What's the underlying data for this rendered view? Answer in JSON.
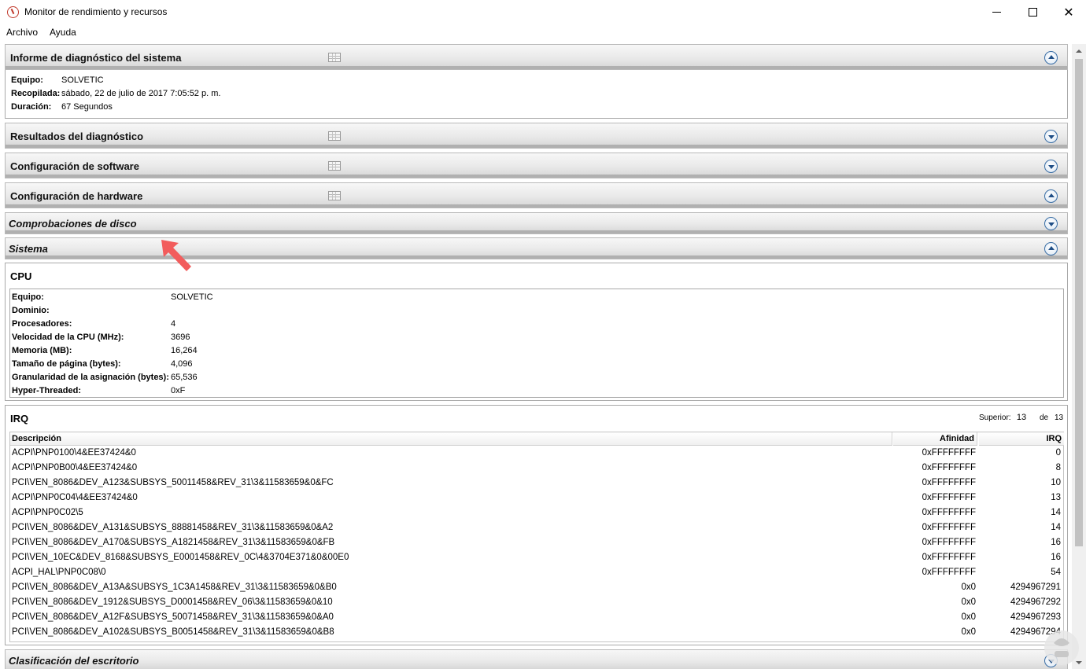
{
  "window": {
    "title": "Monitor de rendimiento y recursos",
    "minimize_icon": "minimize-icon",
    "maximize_icon": "maximize-icon",
    "close_glyph": "✕"
  },
  "menu": {
    "items": [
      "Archivo",
      "Ayuda"
    ]
  },
  "sections": {
    "informe": {
      "title": "Informe de diagnóstico del sistema",
      "expanded": true,
      "fields": [
        {
          "label": "Equipo:",
          "value": "SOLVETIC"
        },
        {
          "label": "Recopilada:",
          "value": "sábado, 22 de julio de 2017 7:05:52 p. m."
        },
        {
          "label": "Duración:",
          "value": "67 Segundos"
        }
      ]
    },
    "resultados": {
      "title": "Resultados del diagnóstico",
      "expanded": false
    },
    "software": {
      "title": "Configuración de software",
      "expanded": false
    },
    "hardware": {
      "title": "Configuración de hardware",
      "expanded": true
    },
    "disco": {
      "title": "Comprobaciones de disco",
      "expanded": false
    },
    "sistema": {
      "title": "Sistema",
      "expanded": true
    },
    "escritorio": {
      "title": "Clasificación del escritorio",
      "expanded": false
    }
  },
  "cpu": {
    "title": "CPU",
    "fields": [
      {
        "label": "Equipo:",
        "value": "SOLVETIC"
      },
      {
        "label": "Dominio:",
        "value": ""
      },
      {
        "label": "Procesadores:",
        "value": "4"
      },
      {
        "label": "Velocidad de la CPU (MHz):",
        "value": "3696"
      },
      {
        "label": "Memoria (MB):",
        "value": "16,264"
      },
      {
        "label": "Tamaño de página (bytes):",
        "value": "4,096"
      },
      {
        "label": "Granularidad de la asignación (bytes):",
        "value": "65,536"
      },
      {
        "label": "Hyper-Threaded:",
        "value": "0xF"
      }
    ]
  },
  "irq": {
    "title": "IRQ",
    "superior_label": "Superior:",
    "superior_value": "13",
    "de_label": "de",
    "de_value": "13",
    "columns": [
      "Descripción",
      "Afinidad",
      "IRQ"
    ],
    "rows": [
      [
        "ACPI\\PNP0100\\4&EE37424&0",
        "0xFFFFFFFF",
        "0"
      ],
      [
        "ACPI\\PNP0B00\\4&EE37424&0",
        "0xFFFFFFFF",
        "8"
      ],
      [
        "PCI\\VEN_8086&DEV_A123&SUBSYS_50011458&REV_31\\3&11583659&0&FC",
        "0xFFFFFFFF",
        "10"
      ],
      [
        "ACPI\\PNP0C04\\4&EE37424&0",
        "0xFFFFFFFF",
        "13"
      ],
      [
        "ACPI\\PNP0C02\\5",
        "0xFFFFFFFF",
        "14"
      ],
      [
        "PCI\\VEN_8086&DEV_A131&SUBSYS_88881458&REV_31\\3&11583659&0&A2",
        "0xFFFFFFFF",
        "14"
      ],
      [
        "PCI\\VEN_8086&DEV_A170&SUBSYS_A1821458&REV_31\\3&11583659&0&FB",
        "0xFFFFFFFF",
        "16"
      ],
      [
        "PCI\\VEN_10EC&DEV_8168&SUBSYS_E0001458&REV_0C\\4&3704E371&0&00E0",
        "0xFFFFFFFF",
        "16"
      ],
      [
        "ACPI_HAL\\PNP0C08\\0",
        "0xFFFFFFFF",
        "54"
      ],
      [
        "PCI\\VEN_8086&DEV_A13A&SUBSYS_1C3A1458&REV_31\\3&11583659&0&B0",
        "0x0",
        "4294967291"
      ],
      [
        "PCI\\VEN_8086&DEV_1912&SUBSYS_D0001458&REV_06\\3&11583659&0&10",
        "0x0",
        "4294967292"
      ],
      [
        "PCI\\VEN_8086&DEV_A12F&SUBSYS_50071458&REV_31\\3&11583659&0&A0",
        "0x0",
        "4294967293"
      ],
      [
        "PCI\\VEN_8086&DEV_A102&SUBSYS_B0051458&REV_31\\3&11583659&0&B8",
        "0x0",
        "4294967294"
      ]
    ]
  },
  "colors": {
    "header_gradient_top": "#f7f7f7",
    "header_gradient_bottom": "#d4d4d4",
    "toggle_blue": "#1f4e86",
    "annotation_arrow": "#f25c5c"
  }
}
